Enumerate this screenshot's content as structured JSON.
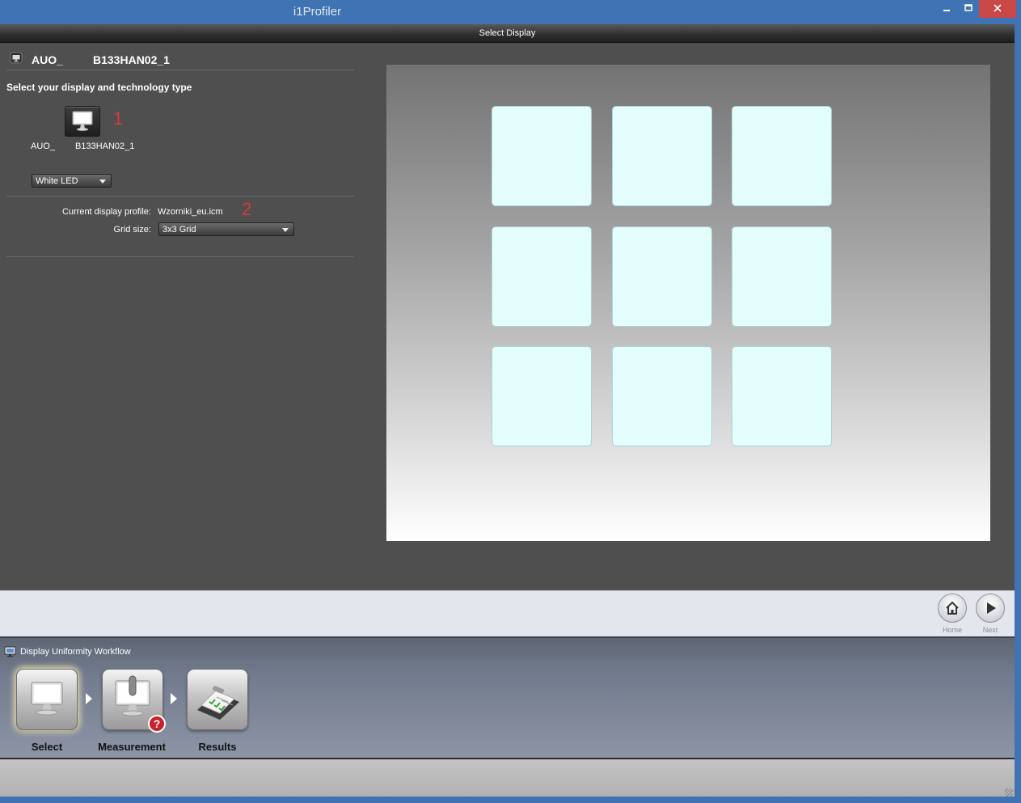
{
  "window": {
    "title": "i1Profiler",
    "minimize_icon": "minimize-icon",
    "maximize_icon": "maximize-icon",
    "close_icon": "close-icon",
    "accent": "#3f73b3"
  },
  "header": {
    "title": "Select Display"
  },
  "display_panel": {
    "vendor": "AUO_",
    "model": "B133HAN02_1",
    "section_label": "Select your display and technology type",
    "display_button_vendor": "AUO_",
    "display_button_model": "B133HAN02_1",
    "annotation_1": "1",
    "annotation_2": "2",
    "technology": {
      "selected": "White LED"
    },
    "current_profile_label": "Current display profile:",
    "current_profile_value": "Wzorniki_eu.icm",
    "grid_size_label": "Grid size:",
    "grid_size": {
      "selected": "3x3 Grid"
    }
  },
  "preview": {
    "rows": 3,
    "cols": 3,
    "cell_color": "#e3fefd"
  },
  "nav": {
    "home_label": "Home",
    "next_label": "Next"
  },
  "workflow": {
    "title": "Display Uniformity Workflow",
    "steps": [
      {
        "label": "Select",
        "icon": "monitor-icon",
        "active": true
      },
      {
        "label": "Measurement",
        "icon": "monitor-measure-icon",
        "active": false,
        "badge": "?"
      },
      {
        "label": "Results",
        "icon": "clipboard-checklist-icon",
        "active": false
      }
    ]
  }
}
